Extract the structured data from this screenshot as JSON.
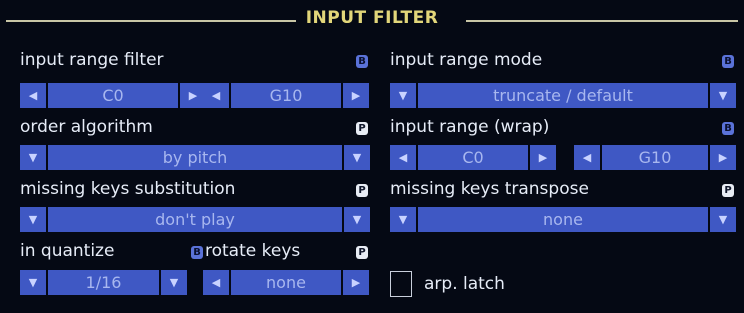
{
  "header": {
    "title": "INPUT FILTER"
  },
  "input_range_filter": {
    "label": "input range filter",
    "badge": "B",
    "low": "C0",
    "high": "G10"
  },
  "input_range_mode": {
    "label": "input range mode",
    "badge": "B",
    "value": "truncate / default"
  },
  "order_algorithm": {
    "label": "order algorithm",
    "badge": "P",
    "value": "by pitch"
  },
  "input_range_wrap": {
    "label": "input range (wrap)",
    "badge": "B",
    "low": "C0",
    "high": "G10"
  },
  "missing_keys_substitution": {
    "label": "missing keys substitution",
    "badge": "P",
    "value": "don't play"
  },
  "missing_keys_transpose": {
    "label": "missing keys transpose",
    "badge": "P",
    "value": "none"
  },
  "in_quantize": {
    "label": "in quantize",
    "badge": "B",
    "value": "1/16"
  },
  "rotate_keys": {
    "label": "rotate keys",
    "badge": "P",
    "value": "none"
  },
  "arp_latch": {
    "label": "arp. latch",
    "checked": false
  },
  "glyphs": {
    "left": "◀",
    "right": "▶",
    "down": "▼"
  },
  "colors": {
    "background": "#050914",
    "control": "#3f58c4",
    "title": "#e2d67a",
    "badge_b": "#5a72d8",
    "badge_p": "#e8ecf4"
  }
}
